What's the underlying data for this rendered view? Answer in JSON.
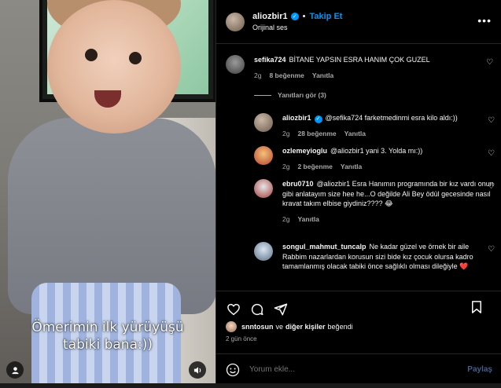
{
  "media": {
    "caption_line1": "Ömerimin ilk yürüyüşü",
    "caption_line2": "tabiki bana:))",
    "user_icon": "user-icon",
    "sound_icon": "speaker-icon"
  },
  "header": {
    "username": "aliozbir1",
    "separator": "•",
    "follow_label": "Takip Et",
    "audio": "Orijinal ses",
    "more_label": "•••"
  },
  "comments": [
    {
      "username": "sefika724",
      "text": "BİTANE YAPSIN ESRA HANIM ÇOK GUZEL",
      "time": "2g",
      "likes": "8 beğenme",
      "reply": "Yanıtla"
    },
    {
      "username": "aliozbir1",
      "text": "@sefika724 farketmedinmi esra kilo aldı:))",
      "time": "2g",
      "likes": "28 beğenme",
      "reply": "Yanıtla"
    },
    {
      "username": "ozlemeyioglu",
      "text": "@aliozbir1 yani 3. Yolda mı:))",
      "time": "2g",
      "likes": "2 beğenme",
      "reply": "Yanıtla"
    },
    {
      "username": "ebru0710",
      "text": "@aliozbir1 Esra Hanımın programında bir kız vardı onun gibi anlatayım size hee he...O değilde Ali Bey ödül gecesinde nasıl kravat takım elbise giydiniz???? 😂",
      "time": "2g",
      "reply": "Yanıtla"
    },
    {
      "username": "songul_mahmut_tuncalp",
      "text": "Ne kadar güzel ve örnek bir aile Rabbim nazarlardan korusun sizi bide kız çocuk olursa kadro tamamlanmış olacak tabiki önce sağlıklı olması dileğiyle ❤️"
    }
  ],
  "view_replies": "Yanıtları gör (3)",
  "actions": {
    "liked_user": "snntosun",
    "liked_connector": "ve",
    "liked_others": "diğer kişiler",
    "liked_suffix": "beğendi",
    "time_ago": "2 gün önce"
  },
  "composer": {
    "placeholder": "Yorum ekle...",
    "share_label": "Paylaş"
  },
  "colors": {
    "accent": "#0095f6",
    "background": "#000000",
    "muted": "#a8a8a8"
  }
}
